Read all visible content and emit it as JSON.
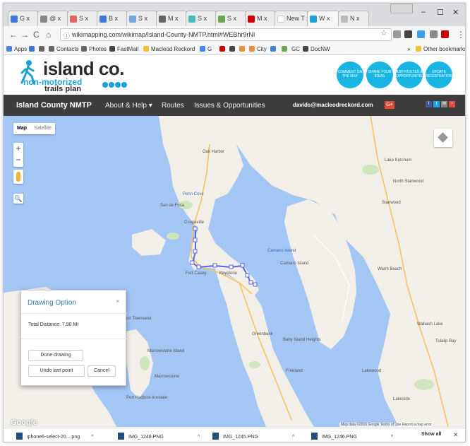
{
  "browser": {
    "tabs": [
      {
        "label": "G x",
        "color": "#3c78d8"
      },
      {
        "label": "@ x",
        "color": "#888888"
      },
      {
        "label": "S x",
        "color": "#e06666"
      },
      {
        "label": "B x",
        "color": "#3c78d8"
      },
      {
        "label": "S x",
        "color": "#6fa8dc"
      },
      {
        "label": "M x",
        "color": "#666666"
      },
      {
        "label": "S x",
        "color": "#46bdc6"
      },
      {
        "label": "S x",
        "color": "#6aa84f"
      },
      {
        "label": "M x",
        "color": "#cc0000"
      },
      {
        "label": "New T x",
        "color": "#ffffff"
      },
      {
        "label": "W x",
        "color": "#1aa1d9"
      },
      {
        "label": "N x",
        "color": "#bbbbbb"
      }
    ],
    "url": "wikimapping.com/wikimap/Island-County-NMTP.html#WEBhr9rNI",
    "bookmarks": [
      {
        "label": "Apps",
        "color": "#4a86e8"
      },
      {
        "label": "",
        "color": "#3c78d8"
      },
      {
        "label": "Contacts",
        "color": "#666666"
      },
      {
        "label": "Photos",
        "color": "#666666"
      },
      {
        "label": "FastMail",
        "color": "#444444"
      },
      {
        "label": "Macleod Reckord",
        "color": "#f1c232"
      },
      {
        "label": "G",
        "color": "#4285f4"
      },
      {
        "label": "",
        "color": "#cc0000"
      },
      {
        "label": "",
        "color": "#444444"
      },
      {
        "label": "",
        "color": "#e69138"
      },
      {
        "label": "City",
        "color": "#e69138"
      },
      {
        "label": "",
        "color": "#3d85c6"
      },
      {
        "label": "GC",
        "color": "#6aa84f"
      },
      {
        "label": "DocNW",
        "color": "#444444"
      }
    ],
    "other_bookmarks": "Other bookmarks"
  },
  "site": {
    "logo_line1": "island co.",
    "logo_line2": "non-motorized",
    "logo_line3": "trails plan",
    "circles": [
      {
        "text": "COMMENT ON THE MAP"
      },
      {
        "text": "SHARE YOUR IDEAS"
      },
      {
        "text": "ADD ROUTES & OPPORTUNITIES"
      },
      {
        "text": "UPDATE REGISTRATION"
      }
    ],
    "nav": {
      "brand": "Island County NMTP",
      "about": "About & Help ▾",
      "routes": "Routes",
      "issues": "Issues & Opportunities",
      "email": "davids@macleodreckord.com",
      "gplus": "G+"
    }
  },
  "map": {
    "type_map": "Map",
    "type_satellite": "Satellite",
    "zoom_in": "+",
    "zoom_out": "−",
    "search": "🔍",
    "labels": [
      {
        "text": "Oak Harbor",
        "water": false
      },
      {
        "text": "Penn Cove",
        "water": true
      },
      {
        "text": "San de Fuca",
        "water": false
      },
      {
        "text": "Coupeville",
        "water": false
      },
      {
        "text": "Fort Casey",
        "water": false
      },
      {
        "text": "Keystone",
        "water": false
      },
      {
        "text": "Camano Island",
        "water": true
      },
      {
        "text": "Camano Island",
        "water": false
      },
      {
        "text": "Lake Ketchum",
        "water": false
      },
      {
        "text": "North Stanwood",
        "water": false
      },
      {
        "text": "Stanwood",
        "water": false
      },
      {
        "text": "Warm Beach",
        "water": false
      },
      {
        "text": "Port Townsend",
        "water": false
      },
      {
        "text": "Marrowstone Island",
        "water": false
      },
      {
        "text": "Marrowstone",
        "water": false
      },
      {
        "text": "Greenbank",
        "water": false
      },
      {
        "text": "Baby Island Heights",
        "water": false
      },
      {
        "text": "Freeland",
        "water": false
      },
      {
        "text": "Lakewood",
        "water": false
      },
      {
        "text": "Wabash Lake",
        "water": false
      },
      {
        "text": "Tulalip Bay",
        "water": false
      },
      {
        "text": "Lakeside",
        "water": false
      },
      {
        "text": "Port Hadlock-Irondale",
        "water": false
      }
    ],
    "google": "Google",
    "attribution": "Map data ©2016 Google   Terms of Use   Report a map error"
  },
  "dialog": {
    "title": "Drawing Option",
    "close": "×",
    "distance": "Total Distance: 7.90 MI",
    "done": "Done drawing",
    "undo": "Undo last point",
    "cancel": "Cancel"
  },
  "downloads": {
    "items": [
      {
        "name": "iphone6-select-20....png"
      },
      {
        "name": "IMG_1248.PNG"
      },
      {
        "name": "IMG_1245.PNG"
      },
      {
        "name": "IMG_1246.PNG"
      }
    ],
    "show_all": "Show all"
  }
}
